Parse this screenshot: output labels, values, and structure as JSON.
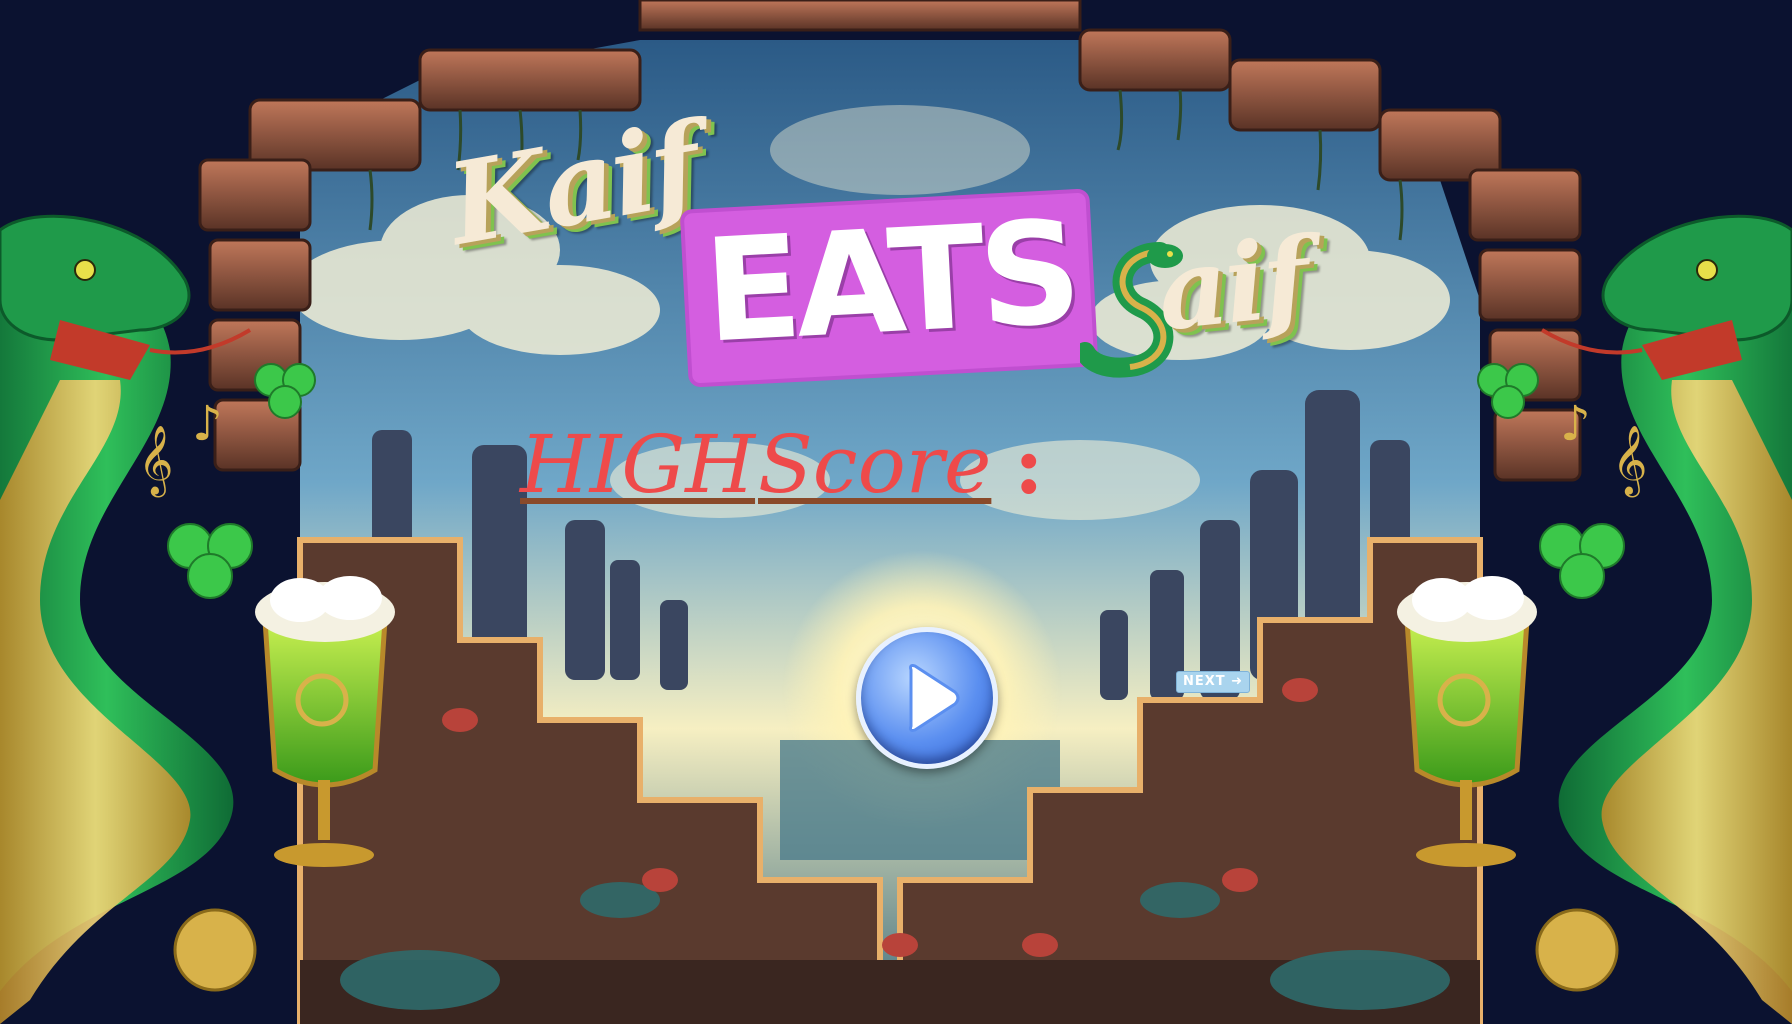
{
  "game": {
    "title_part1": "Kaif",
    "title_part2": "EATS",
    "title_part3": "aif",
    "high_score_word1": "HIGH",
    "high_score_word2": "Score",
    "high_score_colon": ":",
    "play_button_icon": "play-icon",
    "next_button_label": "NEXT",
    "next_button_icon": "arrow-right-icon"
  },
  "colors": {
    "title_cream": "#f6ead6",
    "eats_box": "#d45ee0",
    "high_score_red": "#ee4a4a",
    "play_button_blue": "#5b8ff0",
    "next_button_blue": "#a9d4ee",
    "snake_green": "#1f9a4a",
    "snake_gold": "#d8b24a"
  }
}
